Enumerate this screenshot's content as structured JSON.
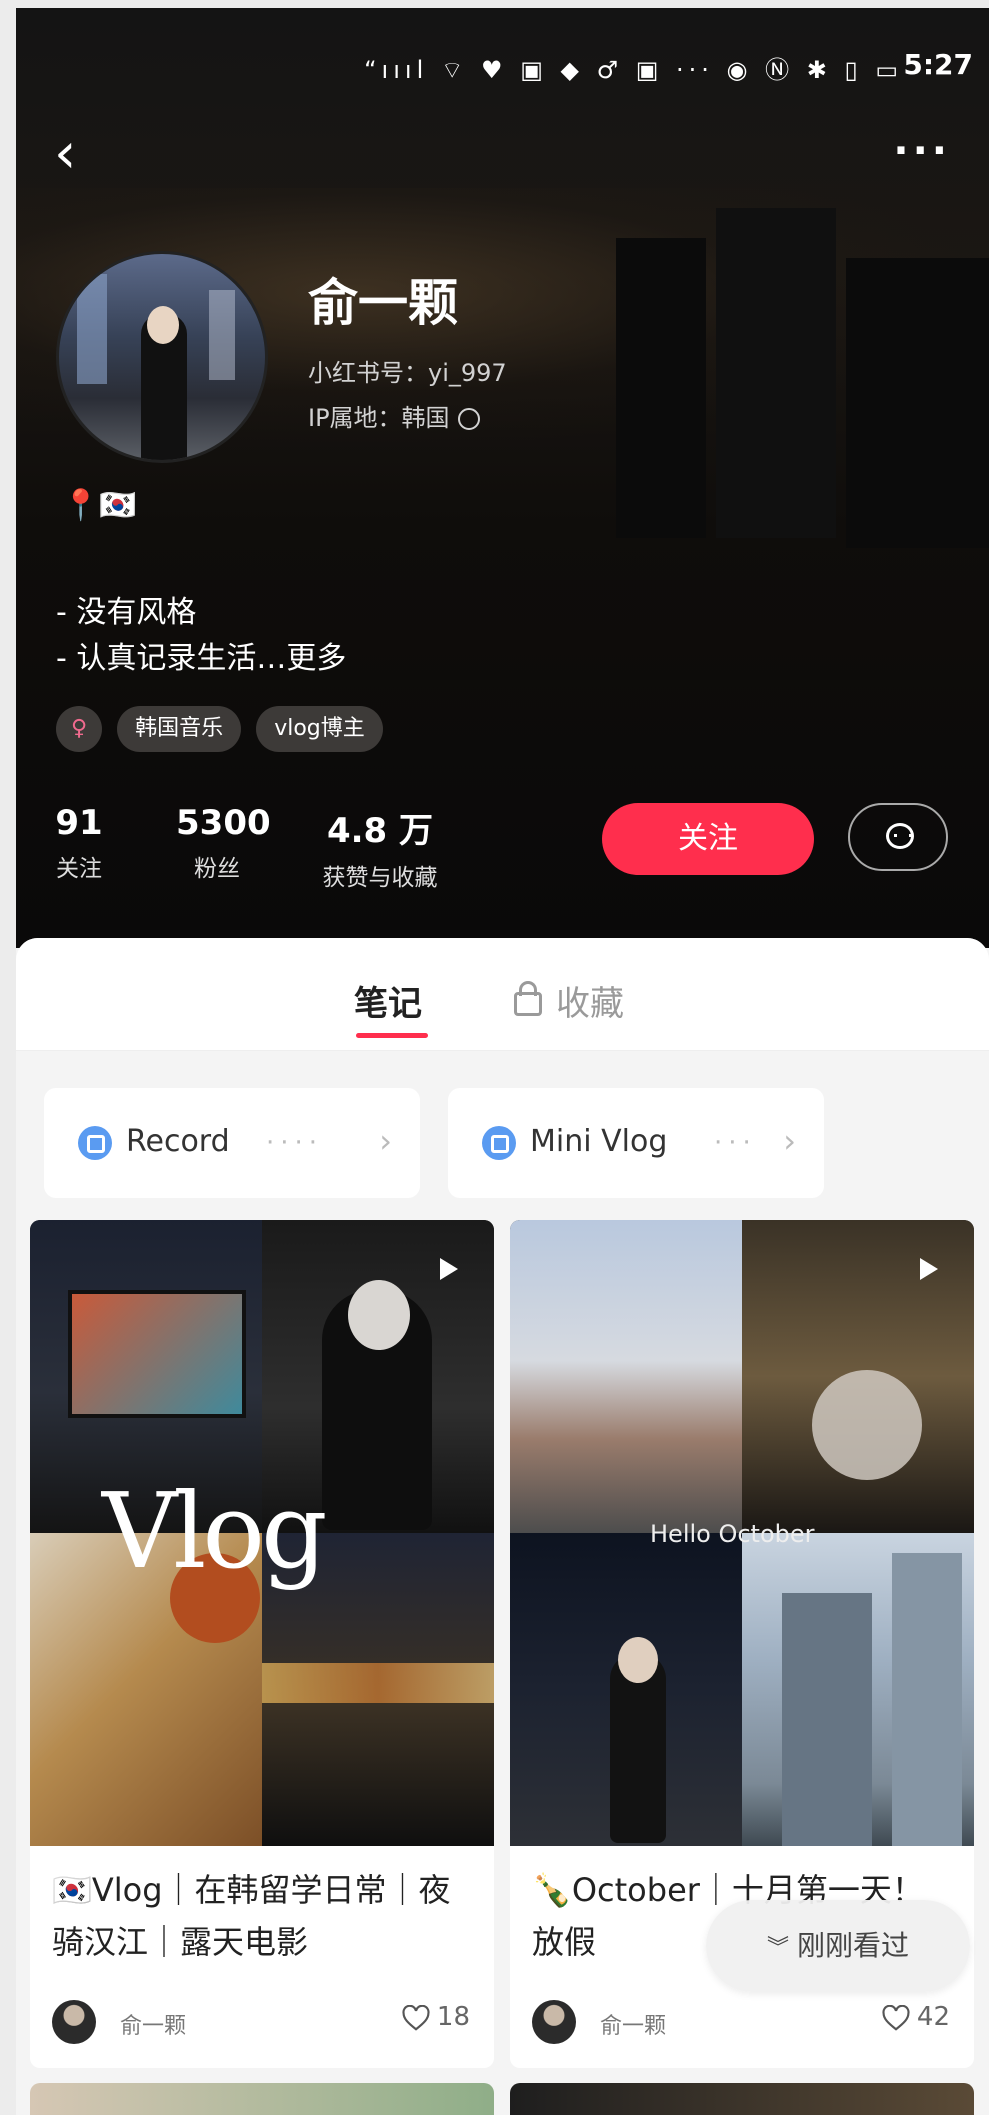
{
  "status_bar": {
    "icons": "“ıııl ⌔ ♥ ▣ ◆ ♂ ▣ ··· ◉ Ⓝ ✱ ▯ ▭",
    "time": "5:27"
  },
  "header": {
    "back_icon": "chevron-left",
    "more_icon": "ellipsis",
    "name": "俞一颗",
    "red_id": "小红书号：yi_997",
    "ip_location": "IP属地：韩国",
    "location_emoji": "📍🇰🇷",
    "bio_lines": [
      "- 没有风格",
      "- 认真记录生活…更多"
    ],
    "tags": [
      "♀",
      "韩国音乐",
      "vlog博主"
    ],
    "stats": [
      {
        "value": "91",
        "label": "关注"
      },
      {
        "value": "5300",
        "label": "粉丝"
      },
      {
        "value": "4.8 万",
        "label": "获赞与收藏"
      }
    ],
    "follow_label": "关注",
    "message_icon": "chat-bubble"
  },
  "tabs": {
    "notes": "笔记",
    "collected": "收藏"
  },
  "collections": [
    {
      "title": "Record",
      "icon": "collection-icon"
    },
    {
      "title": "Mini Vlog",
      "icon": "collection-icon"
    }
  ],
  "notes": [
    {
      "caption": "🇰🇷Vlog｜在韩留学日常｜夜骑汉江｜露天电影",
      "author": "俞一颗",
      "likes": "18",
      "overlay_text": "Vlog"
    },
    {
      "caption": "🍾October｜十月第一天！放假",
      "author": "俞一颗",
      "likes": "42",
      "overlay_text": "Hello October"
    }
  ],
  "recent_button": {
    "label": "刚刚看过",
    "icon": "double-chevron-down"
  }
}
